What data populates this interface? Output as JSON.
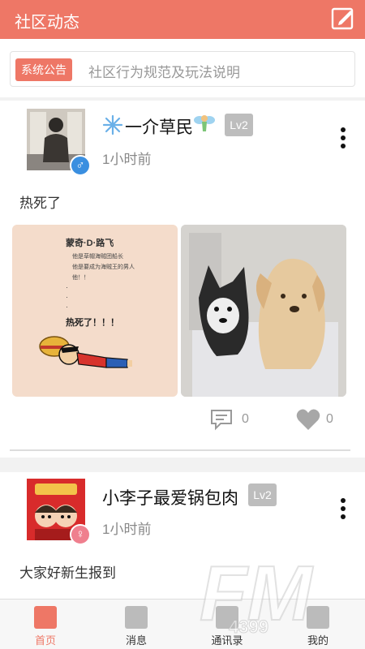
{
  "header": {
    "title": "社区动态"
  },
  "notice": {
    "tag": "系统公告",
    "text": "社区行为规范及玩法说明"
  },
  "posts": [
    {
      "username": "一介草民",
      "level": "Lv2",
      "time": "1小时前",
      "content": "热死了",
      "gender": "♂",
      "comments": "0",
      "likes": "0",
      "image1": {
        "title": "蒙奇·D·路飞",
        "lines": [
          "他是草帽海贼团船长",
          "他是要成为海贼王的男人",
          "他！！",
          "·",
          "·",
          "·"
        ],
        "punch": "热死了！！！"
      }
    },
    {
      "username": "小李子最爱锅包肉",
      "level": "Lv2",
      "time": "1小时前",
      "content": "大家好新生报到",
      "gender": "♀"
    }
  ],
  "tabs": [
    "首页",
    "消息",
    "通讯录",
    "我的"
  ],
  "watermark": {
    "text": "FM",
    "sub": "4399"
  },
  "colors": {
    "accent": "#ee7766",
    "male": "#3a8fe0",
    "female": "#ef7f8e"
  }
}
